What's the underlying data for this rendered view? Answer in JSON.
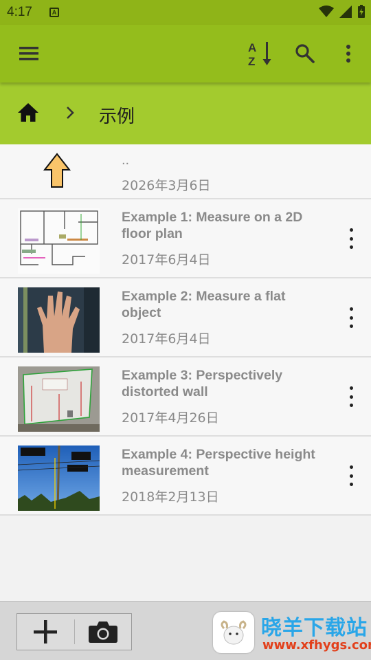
{
  "status": {
    "time": "4:17",
    "notif": "A"
  },
  "breadcrumb": {
    "folder": "示例"
  },
  "parent": {
    "label": "..",
    "date": "2026年3月6日"
  },
  "items": [
    {
      "title": "Example 1: Measure on a 2D floor plan",
      "date": "2017年6月4日",
      "thumb": "floor-plan"
    },
    {
      "title": "Example 2: Measure a flat object",
      "date": "2017年6月4日",
      "thumb": "hand"
    },
    {
      "title": "Example 3: Perspectively distorted wall",
      "date": "2017年4月26日",
      "thumb": "wall"
    },
    {
      "title": "Example 4: Perspective height measurement",
      "date": "2018年2月13日",
      "thumb": "pole"
    }
  ],
  "watermark": {
    "name": "晓羊下载站",
    "url": "www.xfhygs.com"
  },
  "colors": {
    "toolbar": "#94bd1c",
    "breadcrumb": "#a3cb2e",
    "status": "#8fb418"
  },
  "icons": [
    "menu-icon",
    "sort-az-icon",
    "search-icon",
    "overflow-icon",
    "home-icon",
    "chevron-right-icon",
    "up-arrow-icon",
    "add-icon",
    "camera-icon"
  ]
}
